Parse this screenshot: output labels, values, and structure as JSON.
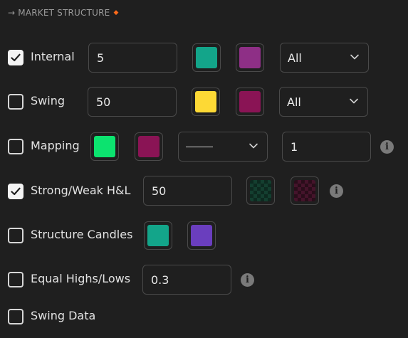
{
  "header": {
    "arrow": "→",
    "title": "MARKET STRUCTURE",
    "dot": "◆",
    "accent_color": "#ff6a1a"
  },
  "rows": {
    "internal": {
      "checked": true,
      "label": "Internal",
      "value": "5",
      "color1": "#13a58a",
      "color2": "#8e2f86",
      "select": "All"
    },
    "swing": {
      "checked": false,
      "label": "Swing",
      "value": "50",
      "color1": "#fdd935",
      "color2": "#8a1455",
      "select": "All"
    },
    "mapping": {
      "checked": false,
      "label": "Mapping",
      "color1": "#0ce36f",
      "color2": "#8a1455",
      "select_style": "solid-line",
      "value": "1"
    },
    "strong_weak": {
      "checked": true,
      "label": "Strong/Weak H&L",
      "value": "50",
      "color1": "checkered-green",
      "color2": "checkered-red"
    },
    "structure_candles": {
      "checked": false,
      "label": "Structure Candles",
      "color1": "#13a58a",
      "color2": "#6a3ebe"
    },
    "equal_hl": {
      "checked": false,
      "label": "Equal Highs/Lows",
      "value": "0.3"
    },
    "swing_data": {
      "checked": false,
      "label": "Swing Data"
    }
  }
}
